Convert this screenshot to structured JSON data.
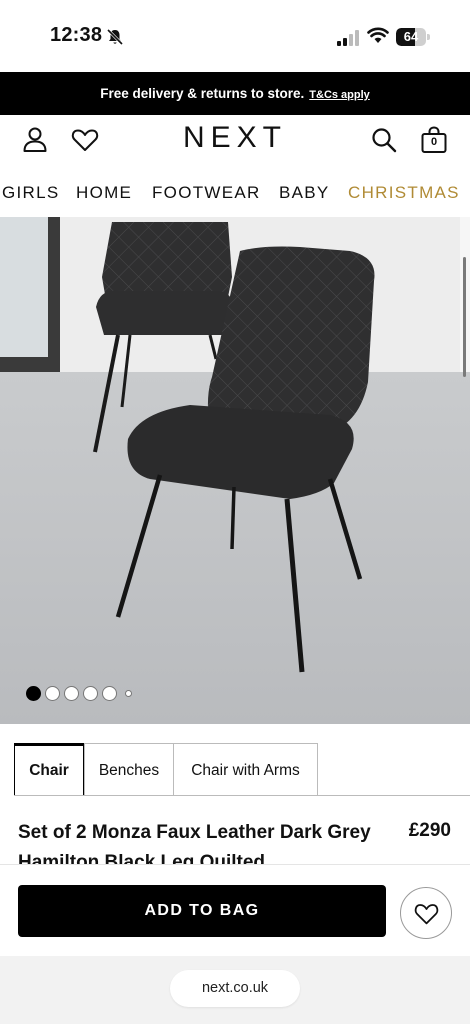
{
  "status_bar": {
    "time": "12:38",
    "battery_level": "64",
    "battery_fraction": 0.64,
    "icons": [
      "bell-muted-icon",
      "signal-icon",
      "wifi-icon",
      "battery-icon"
    ]
  },
  "promo": {
    "text": "Free delivery & returns to store.",
    "link": "T&Cs apply"
  },
  "header": {
    "logo": "NEXT",
    "bag_count": "0",
    "icons": [
      "account-icon",
      "heart-icon",
      "search-icon",
      "bag-icon"
    ]
  },
  "nav": {
    "items": [
      {
        "label": "GIRLS"
      },
      {
        "label": "HOME"
      },
      {
        "label": "FOOTWEAR"
      },
      {
        "label": "BABY"
      },
      {
        "label": "CHRISTMAS"
      }
    ]
  },
  "colors": {
    "accent": "#b08b35",
    "black": "#000000"
  },
  "gallery": {
    "total_images": 6,
    "active_index": 0
  },
  "tabs": [
    {
      "label": "Chair",
      "active": true
    },
    {
      "label": "Benches",
      "active": false
    },
    {
      "label": "Chair with Arms",
      "active": false
    }
  ],
  "product": {
    "title": "Set of 2 Monza Faux Leather Dark Grey Hamilton Black Leg Quilted",
    "price": "£290"
  },
  "actions": {
    "add_to_bag": "ADD TO BAG"
  },
  "browser": {
    "url": "next.co.uk"
  }
}
